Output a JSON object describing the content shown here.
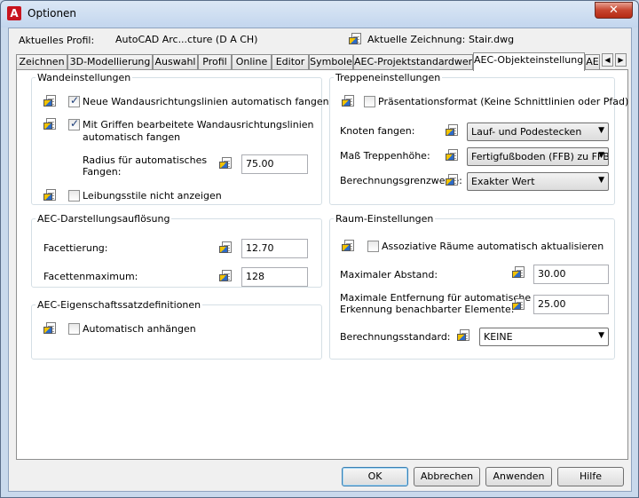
{
  "window": {
    "title": "Optionen",
    "close_glyph": "✕"
  },
  "profile": {
    "profile_label": "Aktuelles Profil:",
    "profile_value": "AutoCAD Arc...cture (D A CH)",
    "drawing_label": "Aktuelle Zeichnung:",
    "drawing_value": "Stair.dwg"
  },
  "tabs": [
    "Zeichnen",
    "3D-Modellierung",
    "Auswahl",
    "Profil",
    "Online",
    "Editor",
    "Symbole",
    "AEC-Projektstandardwerte",
    "AEC-Objekteinstellungen",
    "AE"
  ],
  "tab_scroll": {
    "left": "◀",
    "right": "▶"
  },
  "wall": {
    "title": "Wandeinstellungen",
    "cb1": {
      "label": "Neue Wandausrichtungslinien automatisch fangen",
      "checked": true
    },
    "cb2": {
      "label_line1": "Mit Griffen bearbeitete Wandausrichtungslinien",
      "label_line2": "automatisch fangen",
      "checked": true
    },
    "radius_line1": "Radius für automatisches",
    "radius_line2": "Fangen:",
    "radius_value": "75.00",
    "cb3": {
      "label": "Leibungsstile nicht anzeigen",
      "checked": false
    }
  },
  "stair": {
    "title": "Treppeneinstellungen",
    "cb1": {
      "label": "Präsentationsformat (Keine Schnittlinien oder Pfad)",
      "checked": false
    },
    "snap_label": "Knoten fangen:",
    "snap_value": "Lauf- und Podestecken",
    "height_label": "Maß Treppenhöhe:",
    "height_value": "Fertigfußboden (FFB) zu FFB",
    "limits_label": "Berechnungsgrenzwerte:",
    "limits_value": "Exakter Wert"
  },
  "aec_display": {
    "title": "AEC-Darstellungsauflösung",
    "facet_label": "Facettierung:",
    "facet_value": "12.70",
    "facet_max_label": "Facettenmaximum:",
    "facet_max_value": "128"
  },
  "aec_props": {
    "title": "AEC-Eigenschaftssatzdefinitionen",
    "cb1": {
      "label": "Automatisch anhängen",
      "checked": false
    }
  },
  "room": {
    "title": "Raum-Einstellungen",
    "cb1": {
      "label": "Assoziative Räume automatisch aktualisieren",
      "checked": false
    },
    "max_dist_label": "Maximaler Abstand:",
    "max_dist_value": "30.00",
    "max_detect_line1": "Maximale Entfernung für automatische",
    "max_detect_line2": "Erkennung benachbarter Elemente:",
    "max_detect_value": "25.00",
    "calc_label": "Berechnungsstandard:",
    "calc_value": "KEINE"
  },
  "buttons": {
    "ok": "OK",
    "cancel": "Abbrechen",
    "apply": "Anwenden",
    "help": "Hilfe"
  },
  "colors": {
    "title_bar": "#c3d6ee",
    "close_button": "#c7452f",
    "panel_bg": "#ffffff"
  }
}
